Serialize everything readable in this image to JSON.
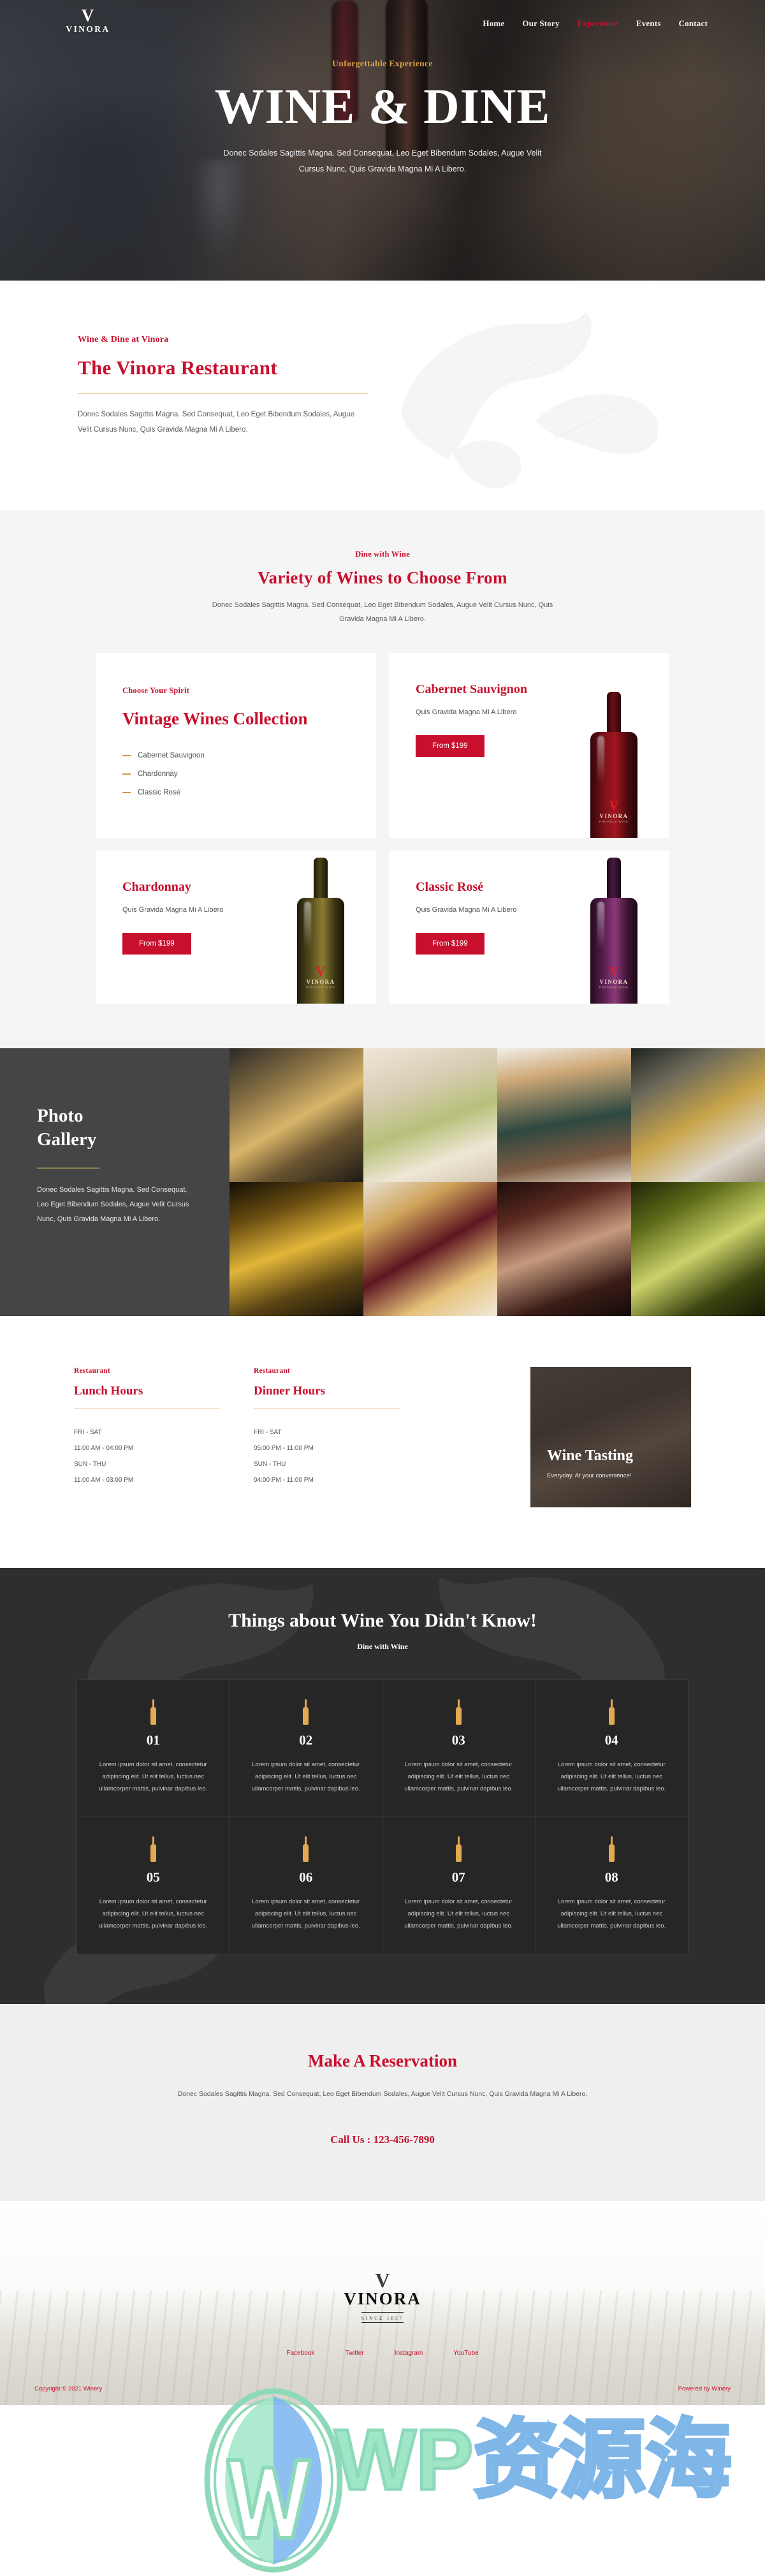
{
  "brand": {
    "mark": "V",
    "name": "VINORA"
  },
  "nav": {
    "items": [
      {
        "label": "Home",
        "active": false
      },
      {
        "label": "Our Story",
        "active": false
      },
      {
        "label": "Experience",
        "active": true
      },
      {
        "label": "Events",
        "active": false
      },
      {
        "label": "Contact",
        "active": false
      }
    ]
  },
  "hero": {
    "eyebrow": "Unforgettable Experience",
    "title": "WINE & DINE",
    "subtitle_line1": "Donec Sodales Sagittis Magna. Sed Consequat, Leo Eget Bibendum Sodales, Augue Velit",
    "subtitle_line2": "Cursus Nunc, Quis Gravida Magna Mi A Libero."
  },
  "intro": {
    "kicker": "Wine & Dine at Vinora",
    "title": "The Vinora Restaurant",
    "body": "Donec Sodales Sagittis Magna. Sed Consequat, Leo Eget Bibendum Sodales, Augue Velit Cursus Nunc, Quis Gravida Magna Mi A Libero."
  },
  "wines": {
    "kicker": "Dine with Wine",
    "title": "Variety of Wines to Choose From",
    "body": "Donec Sodales Sagittis Magna. Sed Consequat, Leo Eget Bibendum Sodales, Augue Velit Cursus Nunc, Quis Gravida Magna Mi A Libero.",
    "collection": {
      "kicker": "Choose Your Spirit",
      "title": "Vintage Wines Collection",
      "items": [
        "Cabernet Sauvignon",
        "Chardonnay",
        "Classic Rosé"
      ]
    },
    "products": [
      {
        "name": "Cabernet Sauvignon",
        "desc": "Quis Gravida Magna Mi A Libero",
        "price_label": "From $199",
        "bottle_style": "b-red"
      },
      {
        "name": "Chardonnay",
        "desc": "Quis Gravida Magna Mi A Libero",
        "price_label": "From $199",
        "bottle_style": "b-green"
      },
      {
        "name": "Classic Rosé",
        "desc": "Quis Gravida Magna Mi A Libero",
        "price_label": "From $199",
        "bottle_style": "b-rose"
      }
    ],
    "bottle_label": {
      "mark": "V",
      "name": "VINORA",
      "sub": "PREMIUM WINE"
    }
  },
  "gallery": {
    "title_line1": "Photo",
    "title_line2": "Gallery",
    "body": "Donec Sodales Sagittis Magna. Sed Consequat, Leo Eget Bibendum Sodales, Augue Velit Cursus Nunc, Quis Gravida Magna Mi A Libero.",
    "photos": [
      "toasting-glasses",
      "table-setting-place-card",
      "woman-drinking-wine",
      "plated-dish-fork",
      "white-wine-glass",
      "canapes-and-wine-shots",
      "rose-wine-glasses",
      "pouring-white-wine"
    ]
  },
  "hours": {
    "lunch": {
      "kicker": "Restaurant",
      "title": "Lunch Hours",
      "lines": [
        "FRI - SAT",
        "11:00 AM - 04:00 PM",
        "SUN - THU",
        "11:00 AM - 03:00 PM"
      ]
    },
    "dinner": {
      "kicker": "Restaurant",
      "title": "Dinner Hours",
      "lines": [
        "FRI - SAT",
        "05:00 PM - 11:00 PM",
        "SUN - THU",
        "04:00 PM - 11:00 PM"
      ]
    },
    "tasting": {
      "title": "Wine Tasting",
      "subtitle": "Everyday. At your convenience!"
    }
  },
  "facts": {
    "title": "Things about Wine You Didn't Know!",
    "kicker": "Dine with Wine",
    "items": [
      {
        "num": "01",
        "text": "Lorem ipsum dolor sit amet, consectetur adipiscing elit. Ut elit tellus, luctus nec ullamcorper mattis, pulvinar dapibus leo."
      },
      {
        "num": "02",
        "text": "Lorem ipsum dolor sit amet, consectetur adipiscing elit. Ut elit tellus, luctus nec ullamcorper mattis, pulvinar dapibus leo."
      },
      {
        "num": "03",
        "text": "Lorem ipsum dolor sit amet, consectetur adipiscing elit. Ut elit tellus, luctus nec ullamcorper mattis, pulvinar dapibus leo."
      },
      {
        "num": "04",
        "text": "Lorem ipsum dolor sit amet, consectetur adipiscing elit. Ut elit tellus, luctus nec ullamcorper mattis, pulvinar dapibus leo."
      },
      {
        "num": "05",
        "text": "Lorem ipsum dolor sit amet, consectetur adipiscing elit. Ut elit tellus, luctus nec ullamcorper mattis, pulvinar dapibus leo."
      },
      {
        "num": "06",
        "text": "Lorem ipsum dolor sit amet, consectetur adipiscing elit. Ut elit tellus, luctus nec ullamcorper mattis, pulvinar dapibus leo."
      },
      {
        "num": "07",
        "text": "Lorem ipsum dolor sit amet, consectetur adipiscing elit. Ut elit tellus, luctus nec ullamcorper mattis, pulvinar dapibus leo."
      },
      {
        "num": "08",
        "text": "Lorem ipsum dolor sit amet, consectetur adipiscing elit. Ut elit tellus, luctus nec ullamcorper mattis, pulvinar dapibus leo."
      }
    ]
  },
  "reservation": {
    "title": "Make A Reservation",
    "body": "Donec Sodales Sagittis Magna. Sed Consequat, Leo Eget Bibendum Sodales, Augue Velit Cursus Nunc, Quis Gravida Magna Mi A Libero.",
    "call": "Call Us : 123-456-7890"
  },
  "footer": {
    "mark": "V",
    "name": "VINORA",
    "since": "SINCE 1857",
    "social": [
      "Facebook",
      "Twitter",
      "Instagram",
      "YouTube"
    ],
    "copyright": "Copyright © 2021 Winery",
    "powered": "Powered by Winery"
  },
  "watermark": {
    "w": "W",
    "p": "P",
    "cn": "资源海"
  },
  "colors": {
    "brand_red": "#c8102e",
    "gold": "#d8a44a",
    "dark": "#2e2e2e",
    "light_gray": "#f5f5f5"
  }
}
